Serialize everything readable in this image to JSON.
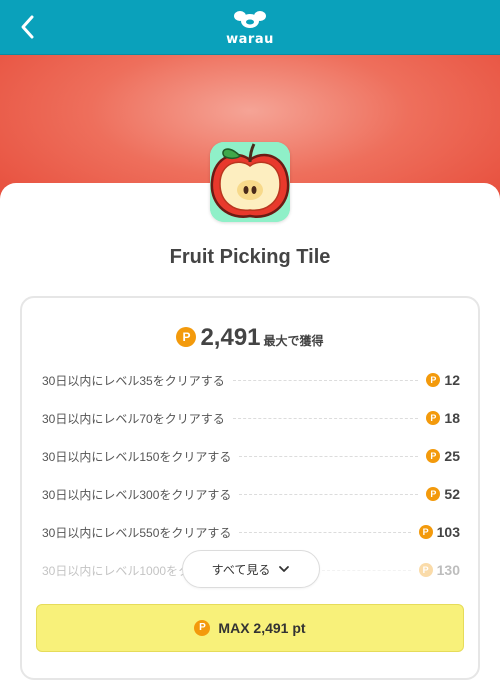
{
  "header": {
    "logo_text": "warau"
  },
  "app": {
    "title": "Fruit Picking Tile"
  },
  "reward": {
    "coin_symbol": "P",
    "total_points": "2,491",
    "total_label": "最大で獲得"
  },
  "tasks": [
    {
      "label": "30日以内にレベル35をクリアする",
      "points": "12"
    },
    {
      "label": "30日以内にレベル70をクリアする",
      "points": "18"
    },
    {
      "label": "30日以内にレベル150をクリアする",
      "points": "25"
    },
    {
      "label": "30日以内にレベル300をクリアする",
      "points": "52"
    },
    {
      "label": "30日以内にレベル550をクリアする",
      "points": "103"
    },
    {
      "label": "30日以内にレベル1000をクリアする",
      "points": "130"
    }
  ],
  "see_all": {
    "label": "すべて見る"
  },
  "max_button": {
    "label": "MAX 2,491 pt"
  },
  "colors": {
    "header_bg": "#0aa1bb",
    "coin": "#f39a0c",
    "max_button_bg": "#f8f17a",
    "hero_red": "#e64a38"
  },
  "icons": [
    "chevron-left-icon",
    "waraú-logo",
    "apple-icon",
    "point-coin-icon",
    "chevron-down-icon"
  ]
}
